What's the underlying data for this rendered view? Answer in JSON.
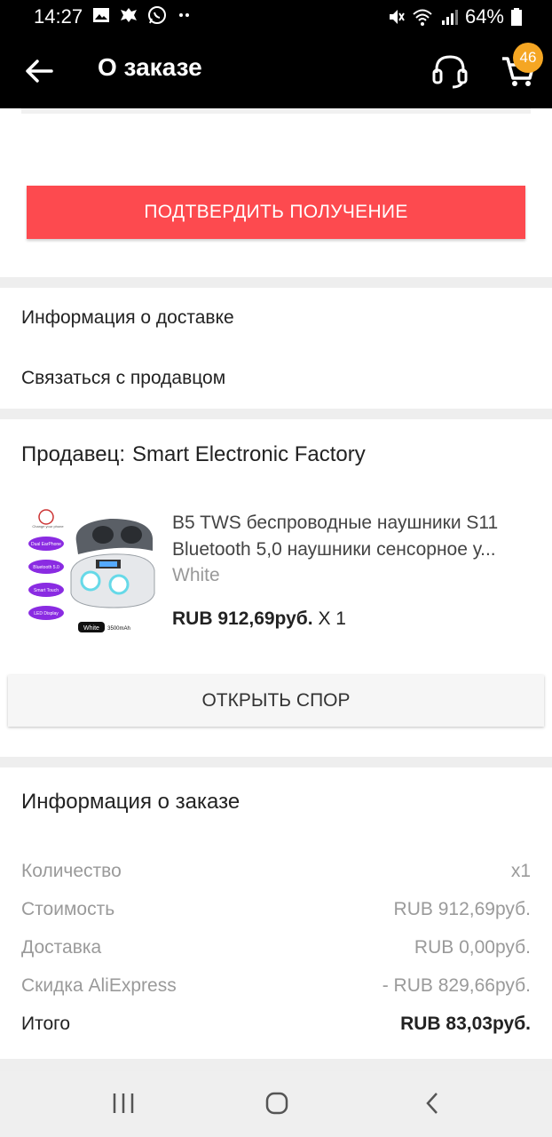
{
  "status_bar": {
    "time": "14:27",
    "battery": "64%"
  },
  "app_bar": {
    "title": "О заказе",
    "cart_badge": "46"
  },
  "actions": {
    "confirm_label": "ПОДТВЕРДИТЬ ПОЛУЧЕНИЕ"
  },
  "links": [
    {
      "label": "Информация о доставке"
    },
    {
      "label": "Связаться с продавцом"
    }
  ],
  "seller": {
    "label": "Продавец:",
    "name": "Smart Electronic Factory"
  },
  "product": {
    "name": "B5 TWS беспроводные наушники S11 Bluetooth 5,0 наушники сенсорное у...",
    "variant": "White",
    "price": "RUB 912,69руб.",
    "qty": "X 1",
    "thumb_labels": [
      "Dual EarPhone",
      "Bluetooth 5.0",
      "Smart Touch",
      "LED Display",
      "White",
      "3500mAh",
      "Change your phone"
    ]
  },
  "dispute": {
    "label": "ОТКРЫТЬ СПОР"
  },
  "order_info": {
    "title": "Информация о заказе",
    "rows": [
      {
        "label": "Количество",
        "value": "x1"
      },
      {
        "label": "Стоимость",
        "value": "RUB 912,69руб."
      },
      {
        "label": "Доставка",
        "value": "RUB 0,00руб."
      },
      {
        "label": "Скидка AliExpress",
        "value": "- RUB 829,66руб."
      },
      {
        "label": "Итого",
        "value": "RUB 83,03руб."
      }
    ]
  },
  "colors": {
    "accent": "#fd4a4f",
    "badge": "#f5a623",
    "app_bar": "#000000"
  },
  "icons": [
    "image-icon",
    "emblem-icon",
    "whatsapp-icon",
    "more-dots-icon",
    "mute-icon",
    "wifi-icon",
    "signal-icon",
    "battery-icon",
    "back-arrow-icon",
    "support-headset-icon",
    "cart-icon",
    "nav-recent-icon",
    "nav-home-icon",
    "nav-back-icon"
  ]
}
